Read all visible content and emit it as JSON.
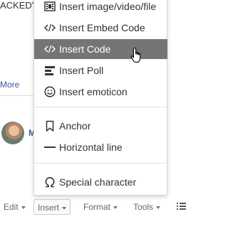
{
  "background": {
    "text_fragment": "ACKED\"",
    "more_link": "More",
    "name_initial": "M"
  },
  "menu": {
    "items": [
      {
        "label": "Insert image/video/file",
        "icon": "image-video-icon"
      },
      {
        "label": "Insert Embed Code",
        "icon": "code-icon"
      },
      {
        "label": "Insert Code",
        "icon": "code-icon",
        "highlighted": true
      },
      {
        "label": "Insert Poll",
        "icon": "poll-icon"
      },
      {
        "label": "Insert emoticon",
        "icon": "smiley-icon"
      },
      {
        "label": "Anchor",
        "icon": "bookmark-icon"
      },
      {
        "label": "Horizontal line",
        "icon": "horizontal-line-icon"
      },
      {
        "label": "Special character",
        "icon": "omega-icon"
      }
    ]
  },
  "toolbar": {
    "edit_label": "Edit",
    "insert_label": "Insert",
    "format_label": "Format",
    "tools_label": "Tools"
  },
  "colors": {
    "highlight": "#757575",
    "link": "#3b5998"
  }
}
